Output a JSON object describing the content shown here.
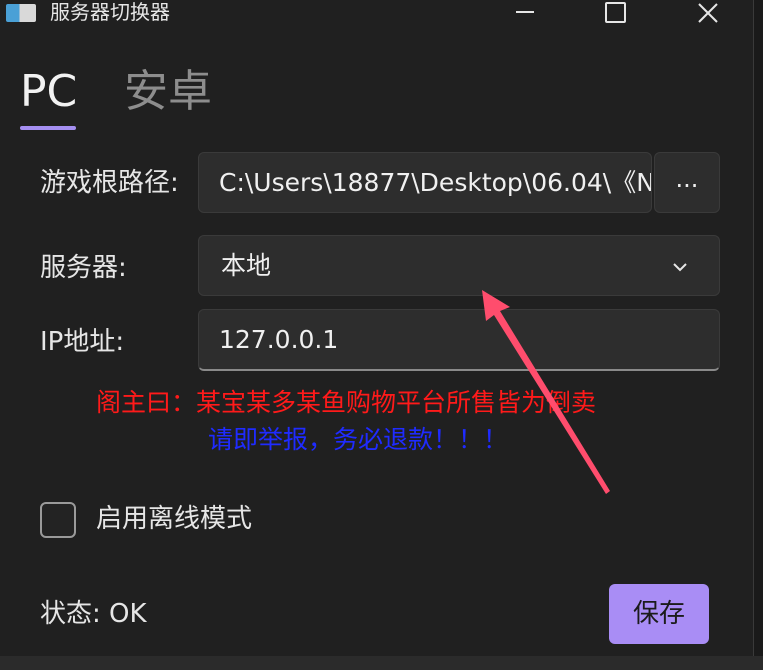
{
  "window": {
    "title": "服务器切换器"
  },
  "tabs": [
    {
      "label": "PC",
      "active": true
    },
    {
      "label": "安卓",
      "active": false
    }
  ],
  "form": {
    "game_root_label": "游戏根路径:",
    "game_root_value": "C:\\Users\\18877\\Desktop\\06.04\\《N",
    "browse_label": "...",
    "server_label": "服务器:",
    "server_value": "本地",
    "ip_label": "IP地址:",
    "ip_value": "127.0.0.1"
  },
  "notice": {
    "line1": "阁主曰：某宝某多某鱼购物平台所售皆为倒卖",
    "line2": "请即举报，务必退款！！！",
    "line1_color": "#ff1a1a",
    "line2_color": "#1f2bff"
  },
  "offline": {
    "label": "启用离线模式",
    "checked": false
  },
  "footer": {
    "status": "状态: OK",
    "save_label": "保存"
  },
  "colors": {
    "accent": "#a98df5",
    "background": "#202020"
  },
  "icons": {
    "app": "app-icon",
    "minimize": "minimize-icon",
    "maximize": "maximize-icon",
    "close": "close-icon",
    "dropdown": "chevron-down-icon",
    "annotation": "red-arrow-icon"
  }
}
